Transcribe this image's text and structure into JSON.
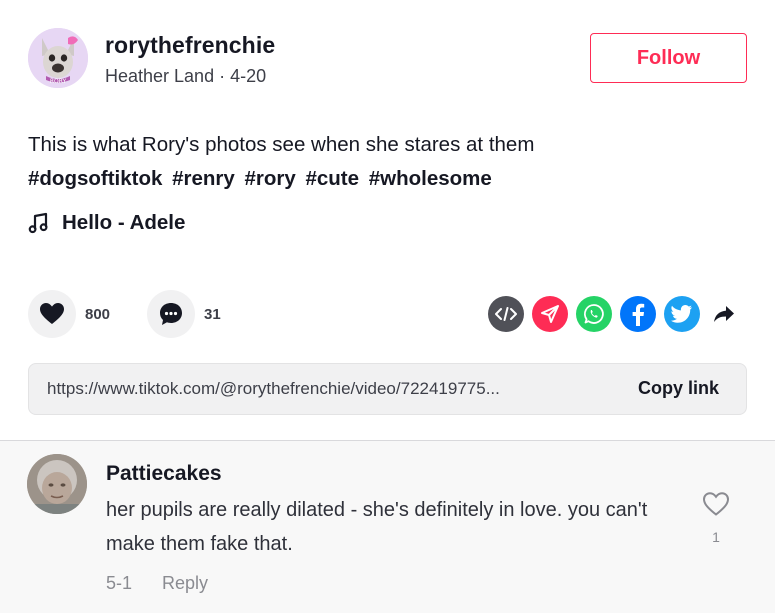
{
  "post": {
    "username": "rorythefrenchie",
    "author": "Heather Land",
    "date": "4-20",
    "subtitle": "Heather Land · 4-20",
    "follow_label": "Follow",
    "description": "This is what Rory's photos see when she stares at them",
    "hashtags": [
      "#dogsoftiktok",
      "#renry",
      "#rory",
      "#cute",
      "#wholesome"
    ],
    "music": "Hello - Adele",
    "avatar_badge_text": "RORY"
  },
  "actions": {
    "likes": "800",
    "comments": "31",
    "share_icons": [
      "embed-icon",
      "send-icon",
      "whatsapp-icon",
      "facebook-icon",
      "twitter-icon",
      "share-arrow-icon"
    ]
  },
  "link": {
    "url": "https://www.tiktok.com/@rorythefrenchie/video/722419775...",
    "copy_label": "Copy link"
  },
  "comments": [
    {
      "author": "Pattiecakes",
      "text": "her pupils are really dilated - she's definitely in love. you can't make them fake that.",
      "date": "5-1",
      "reply_label": "Reply",
      "likes": "1"
    }
  ],
  "colors": {
    "accent": "#fe2c55",
    "text": "#161823",
    "muted": "#8a8b91",
    "panel": "#f1f1f2",
    "whatsapp": "#25d366",
    "facebook": "#0075fa",
    "twitter": "#1da1f2",
    "embed": "#505158"
  }
}
